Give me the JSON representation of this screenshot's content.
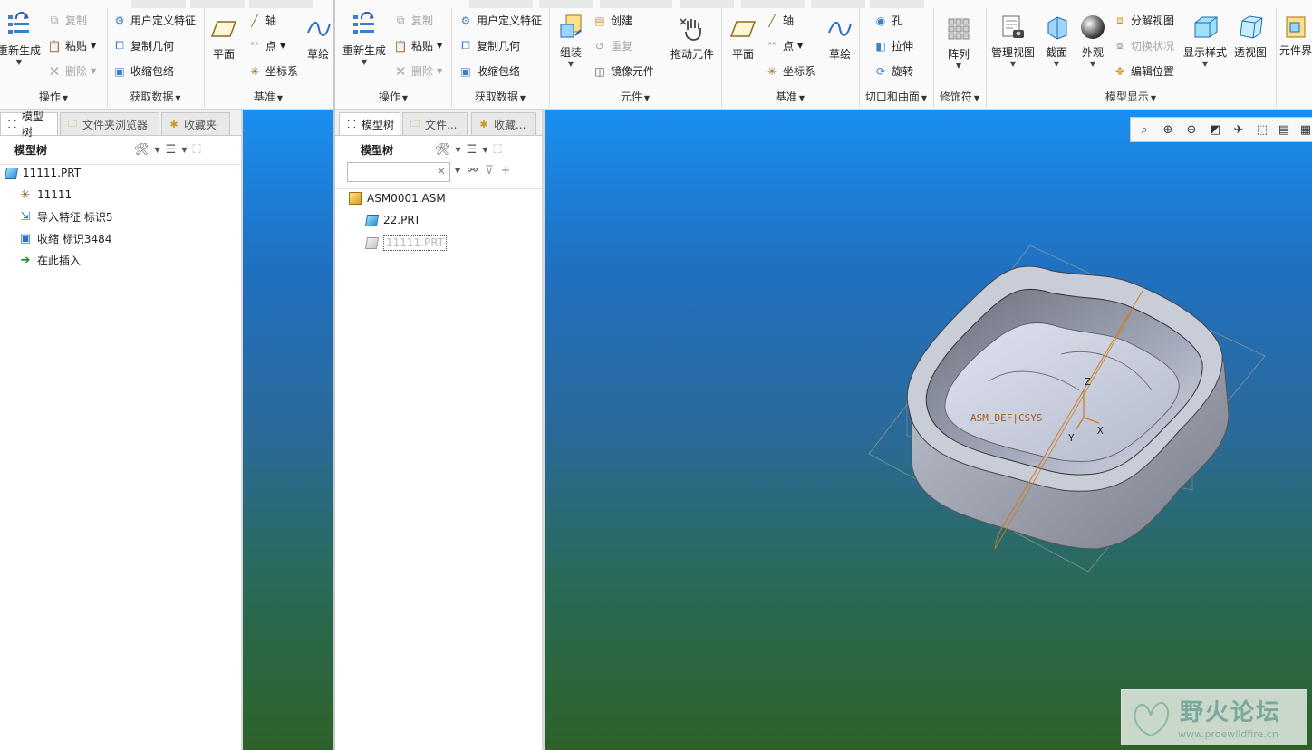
{
  "ribbon_left": {
    "groups": {
      "operations": "操作",
      "get_data": "获取数据",
      "datum": "基准"
    },
    "regenerate": "重新生成",
    "copy": "复制",
    "paste": "粘贴",
    "delete": "删除",
    "user_defined_feature": "用户定义特征",
    "copy_geometry": "复制几何",
    "shrinkwrap": "收缩包络",
    "plane": "平面",
    "axis": "轴",
    "point": "点",
    "csys": "坐标系",
    "sketch": "草绘"
  },
  "ribbon_right": {
    "groups": {
      "operations": "操作",
      "get_data": "获取数据",
      "component": "元件",
      "datum": "基准",
      "cut_surface": "切口和曲面",
      "modifiers": "修饰符",
      "model_display": "模型显示"
    },
    "regenerate": "重新生成",
    "copy": "复制",
    "paste": "粘贴",
    "delete": "删除",
    "user_defined_feature": "用户定义特征",
    "copy_geometry": "复制几何",
    "shrinkwrap": "收缩包络",
    "assemble": "组装",
    "create": "创建",
    "repeat": "重复",
    "mirror_component": "镜像元件",
    "drag_components": "拖动元件",
    "plane": "平面",
    "axis": "轴",
    "point": "点",
    "csys": "坐标系",
    "sketch": "草绘",
    "hole": "孔",
    "extrude": "拉伸",
    "revolve": "旋转",
    "pattern": "阵列",
    "manage_views": "管理视图",
    "section": "截面",
    "appearance": "外观",
    "explode_view": "分解视图",
    "toggle_status": "切换状况",
    "edit_position": "编辑位置",
    "display_style": "显示样式",
    "perspective": "透视图",
    "component_interface": "元件界"
  },
  "left_panel": {
    "tabs": [
      "模型树",
      "文件夹浏览器",
      "收藏夹"
    ],
    "header": "模型树",
    "tree": [
      {
        "label": "11111.PRT",
        "icon": "part-icon"
      },
      {
        "label": "11111",
        "icon": "csys-icon"
      },
      {
        "label": "导入特征 标识5",
        "icon": "import-feature-icon"
      },
      {
        "label": "收缩 标识3484",
        "icon": "shrinkwrap-icon"
      },
      {
        "label": "在此插入",
        "icon": "insert-here-arrow-icon"
      }
    ]
  },
  "mid_panel": {
    "tabs": [
      "模型树",
      "文件...",
      "收藏..."
    ],
    "header": "模型树",
    "search_value": "",
    "tree": [
      {
        "label": "ASM0001.ASM",
        "icon": "assembly-icon"
      },
      {
        "label": "22.PRT",
        "icon": "part-icon"
      },
      {
        "label": "11111.PRT",
        "icon": "part-icon-suppressed"
      }
    ]
  },
  "viewport": {
    "csys_label": "ASM_DEF|CSYS",
    "axis_labels": [
      "Z",
      "Y",
      "X"
    ]
  },
  "watermark": {
    "title": "野火论坛",
    "url": "www.proewildfire.cn"
  },
  "colors": {
    "accent": "#1b6ca8",
    "bg_top": "#1a8ff0",
    "bg_bottom": "#2c6228",
    "datum_orange": "#d07a20"
  }
}
